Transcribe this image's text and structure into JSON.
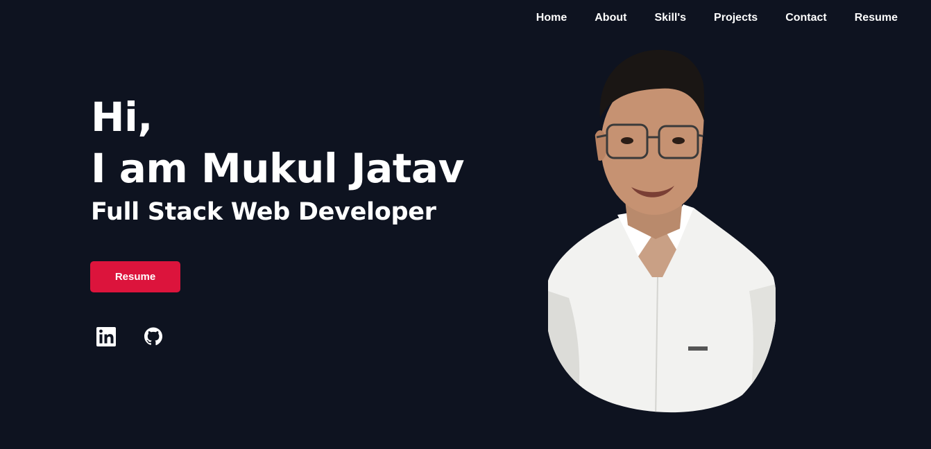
{
  "nav": {
    "items": [
      "Home",
      "About",
      "Skill's",
      "Projects",
      "Contact",
      "Resume"
    ]
  },
  "hero": {
    "greeting": "Hi,",
    "intro": "I am Mukul Jatav",
    "role": "Full Stack Web Developer",
    "resume_label": "Resume"
  },
  "social": {
    "icons": [
      "linkedin-icon",
      "github-icon"
    ]
  },
  "colors": {
    "background": "#0e1320",
    "accent": "#dc143c",
    "text": "#ffffff"
  }
}
